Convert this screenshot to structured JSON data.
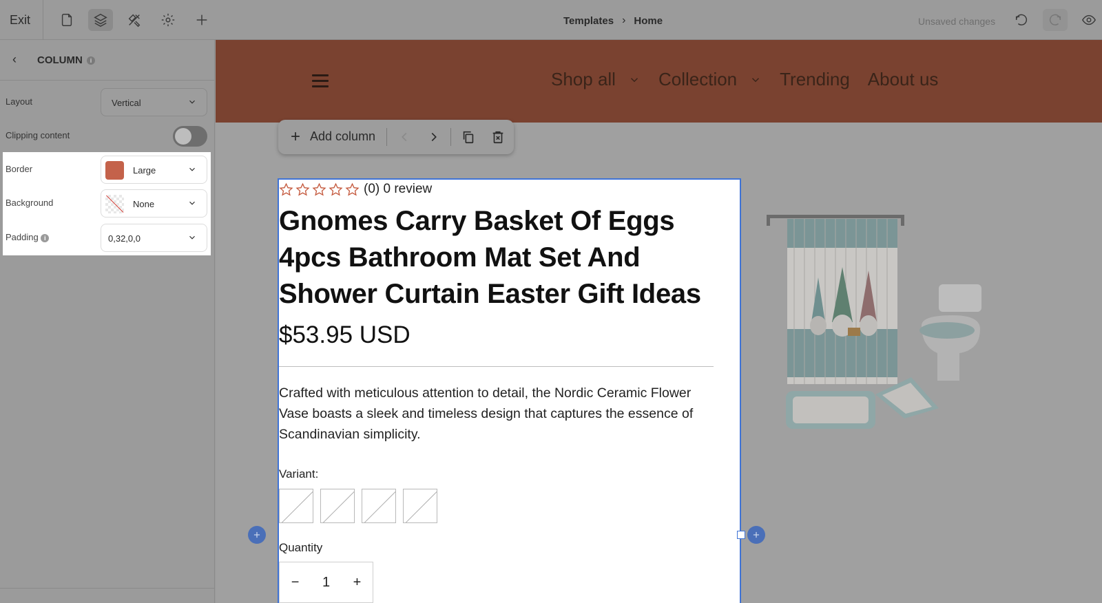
{
  "topbar": {
    "exit_label": "Exit",
    "breadcrumb": [
      "Templates",
      "Home"
    ],
    "status": "Unsaved changes"
  },
  "sidebar": {
    "title": "COLUMN",
    "layout": {
      "label": "Layout",
      "value": "Vertical"
    },
    "clipping": {
      "label": "Clipping content",
      "enabled": false
    },
    "border": {
      "label": "Border",
      "value": "Large",
      "color": "#c4624a"
    },
    "background": {
      "label": "Background",
      "value": "None"
    },
    "padding": {
      "label": "Padding",
      "value": "0,32,0,0"
    }
  },
  "site": {
    "header_color": "#7a4230",
    "nav": [
      "Shop all",
      "Collection",
      "Trending",
      "About us"
    ]
  },
  "column_toolbar": {
    "add_label": "Add column"
  },
  "product": {
    "rating_text": "(0) 0 review",
    "title": "Gnomes Carry Basket Of Eggs 4pcs Bathroom Mat Set And Shower Curtain Easter Gift Ideas",
    "price": "$53.95 USD",
    "description": "Crafted with meticulous attention to detail, the Nordic Ceramic Flower Vase boasts a sleek and timeless design that captures the essence of Scandinavian simplicity.",
    "variant_label": "Variant:",
    "quantity_label": "Quantity",
    "quantity_value": "1",
    "qty_minus": "−",
    "qty_plus": "+"
  },
  "colors": {
    "accent": "#3f73d6",
    "star": "#c4583c"
  }
}
